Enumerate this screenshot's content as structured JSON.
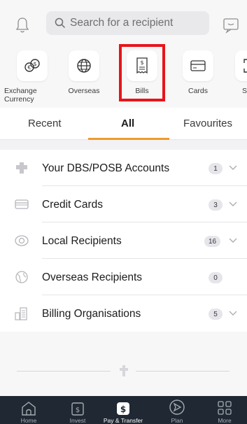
{
  "topbar": {
    "search_placeholder": "Search for a recipient"
  },
  "quick_actions": [
    {
      "label": "Exchange Currency",
      "icon": "exchange-currency-icon"
    },
    {
      "label": "Overseas",
      "icon": "globe-icon"
    },
    {
      "label": "Bills",
      "icon": "bill-icon",
      "highlighted": true
    },
    {
      "label": "Cards",
      "icon": "card-icon"
    },
    {
      "label": "Scan",
      "icon": "scan-icon"
    }
  ],
  "tabs": [
    {
      "label": "Recent"
    },
    {
      "label": "All",
      "active": true
    },
    {
      "label": "Favourites"
    }
  ],
  "recipients": [
    {
      "label": "Your DBS/POSB Accounts",
      "count": "1",
      "icon": "bank-icon",
      "expandable": true
    },
    {
      "label": "Credit Cards",
      "count": "3",
      "icon": "credit-card-icon",
      "expandable": true
    },
    {
      "label": "Local Recipients",
      "count": "16",
      "icon": "local-recipient-icon",
      "expandable": true
    },
    {
      "label": "Overseas Recipients",
      "count": "0",
      "icon": "globe-recipient-icon",
      "expandable": false
    },
    {
      "label": "Billing Organisations",
      "count": "5",
      "icon": "building-icon",
      "expandable": true
    }
  ],
  "bottom_nav": [
    {
      "label": "Home",
      "icon": "home-icon"
    },
    {
      "label": "Invest",
      "icon": "invest-icon"
    },
    {
      "label": "Pay & Transfer",
      "icon": "pay-transfer-icon",
      "active": true
    },
    {
      "label": "Plan",
      "icon": "plan-icon"
    },
    {
      "label": "More",
      "icon": "more-grid-icon"
    }
  ],
  "colors": {
    "accent": "#ee9a2c",
    "highlight_box": "#e8141b",
    "nav_bg": "#1f2833",
    "badge_bg": "#e5e5ea"
  }
}
